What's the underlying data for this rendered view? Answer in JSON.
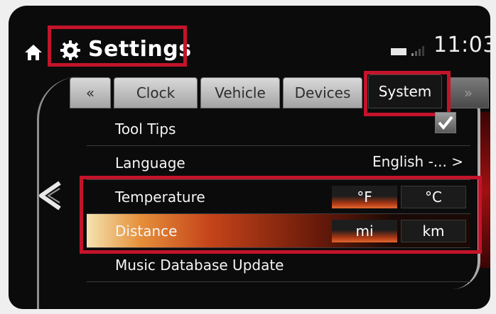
{
  "header": {
    "title": "Settings",
    "time": "11:03"
  },
  "tabs": [
    {
      "label": "«"
    },
    {
      "label": "Clock"
    },
    {
      "label": "Vehicle"
    },
    {
      "label": "Devices"
    },
    {
      "label": "System",
      "selected": true
    },
    {
      "label": "»"
    }
  ],
  "rows": {
    "tool_tips": {
      "label": "Tool Tips",
      "checked": true
    },
    "language": {
      "label": "Language",
      "value": "English -... >"
    },
    "temperature": {
      "label": "Temperature",
      "options": [
        "°F",
        "°C"
      ],
      "selected": "°F"
    },
    "distance": {
      "label": "Distance",
      "options": [
        "mi",
        "km"
      ],
      "selected": "mi"
    },
    "music_db": {
      "label": "Music Database Update"
    }
  },
  "colors": {
    "highlight_box": "#c3142a",
    "active_accent": "#e06a30",
    "background": "#0b0b0c"
  },
  "icons": [
    "home-icon",
    "gear-icon",
    "battery-icon",
    "signal-icon",
    "back-arrow-icon",
    "checkmark-icon"
  ]
}
